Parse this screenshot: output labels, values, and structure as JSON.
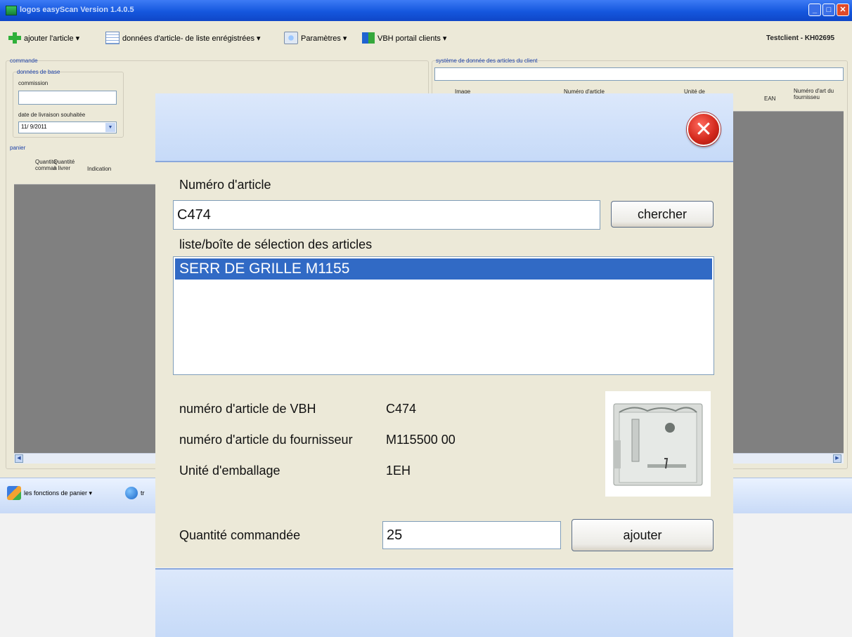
{
  "window": {
    "title": "logos easyScan Version 1.4.0.5",
    "min_glyph": "_",
    "max_glyph": "□",
    "close_glyph": "✕"
  },
  "toolbar": {
    "add_article": "ajouter l'article ▾",
    "article_data": "données d'article- de liste enrégistrées ▾",
    "parameters": "Paramètres ▾",
    "portal": "VBH portail clients ▾",
    "client": "Testclient - KH02695"
  },
  "background": {
    "order_group": "commande",
    "base_data_group": "données de base",
    "commission_label": "commission",
    "delivery_label": "date de livraison souhaitée",
    "delivery_value": "11/ 9/2011",
    "cart_group": "panier",
    "cart_col_qty_ordered": "Quantité comman",
    "cart_col_qty_deliver": "Quantité à livrer",
    "cart_col_indication": "Indication",
    "system_group": "système de donnée des articles du client",
    "sys_col_image": "Image",
    "sys_col_article_no": "Numéro d'article",
    "sys_col_unit": "Unité de",
    "sys_col_ean": "EAN",
    "sys_col_supplier_no": "Numéro d'art du fournisseu",
    "cart_functions": "les fonctions de panier ▾",
    "bottom_next": "tr"
  },
  "dialog": {
    "close_glyph": "✕",
    "article_number_label": "Numéro d'article",
    "article_number_value": "C474",
    "search_button": "chercher",
    "list_label": "liste/boîte de sélection des articles",
    "list_items": [
      "SERR DE GRILLE M1155"
    ],
    "vbh_number_label": "numéro d'article de VBH",
    "vbh_number_value": "C474",
    "supplier_number_label": "numéro d'article du fournisseur",
    "supplier_number_value": "M115500 00",
    "packaging_unit_label": "Unité d'emballage",
    "packaging_unit_value": "1EH",
    "quantity_label": "Quantité commandée",
    "quantity_value": "25",
    "add_button": "ajouter"
  }
}
